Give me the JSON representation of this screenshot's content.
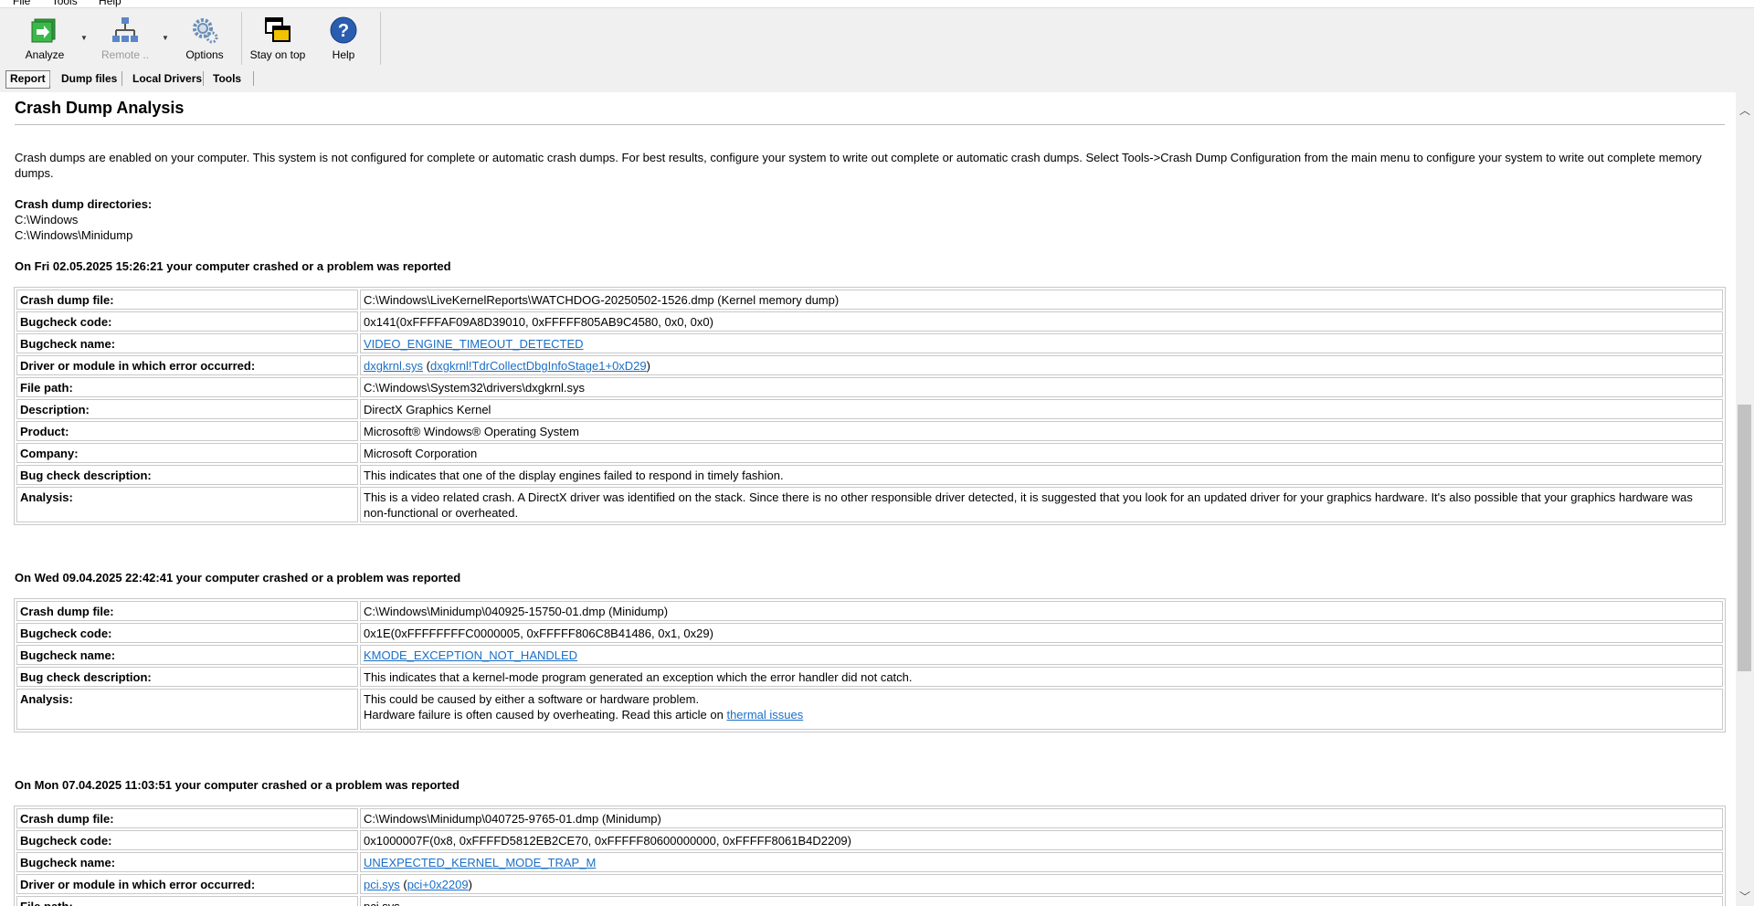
{
  "menu": [
    "File",
    "Tools",
    "Help"
  ],
  "toolbar": {
    "analyze": "Analyze",
    "remote": "Remote ..",
    "options": "Options",
    "stay_on_top": "Stay on top",
    "help": "Help"
  },
  "tabs": [
    "Report",
    "Dump files",
    "Local Drivers",
    "Tools"
  ],
  "report": {
    "title": "Crash Dump Analysis",
    "intro": "Crash dumps are enabled on your computer. This system is not configured for complete or automatic crash dumps. For best results, configure your system to write out complete or automatic crash dumps. Select Tools->Crash Dump Configuration from the main menu to configure your system to write out complete memory dumps.",
    "dirs_label": "Crash dump directories:",
    "dirs": [
      "C:\\Windows",
      "C:\\Windows\\Minidump"
    ]
  },
  "crashes": [
    {
      "title": "On Fri 02.05.2025 15:26:21 your computer crashed or a problem was reported",
      "crash_dump_file_label": "Crash dump file:",
      "crash_dump_file": "C:\\Windows\\LiveKernelReports\\WATCHDOG-20250502-1526.dmp (Kernel memory dump)",
      "bugcheck_code_label": "Bugcheck code:",
      "bugcheck_code": "0x141(0xFFFFAF09A8D39010, 0xFFFFF805AB9C4580, 0x0, 0x0)",
      "bugcheck_name_label": "Bugcheck name:",
      "bugcheck_name": "VIDEO_ENGINE_TIMEOUT_DETECTED",
      "driver_label": "Driver or module in which error occurred:",
      "driver": "dxgkrnl.sys",
      "driver_open": " (",
      "driver_symbol": "dxgkrnl!TdrCollectDbgInfoStage1+0xD29",
      "driver_close": ")",
      "file_path_label": "File path:",
      "file_path": "C:\\Windows\\System32\\drivers\\dxgkrnl.sys",
      "description_label": "Description:",
      "description": "DirectX Graphics Kernel",
      "product_label": "Product:",
      "product": "Microsoft® Windows® Operating System",
      "company_label": "Company:",
      "company": "Microsoft Corporation",
      "bug_check_desc_label": "Bug check description:",
      "bug_check_desc": "This indicates that one of the display engines failed to respond in timely fashion.",
      "analysis_label": "Analysis:",
      "analysis": "This is a video related crash. A DirectX driver was identified on the stack. Since there is no other responsible driver detected, it is suggested that you look for an updated driver for your graphics hardware. It's also possible that your graphics hardware was non-functional or overheated."
    },
    {
      "title": "On Wed 09.04.2025 22:42:41 your computer crashed or a problem was reported",
      "crash_dump_file_label": "Crash dump file:",
      "crash_dump_file": "C:\\Windows\\Minidump\\040925-15750-01.dmp (Minidump)",
      "bugcheck_code_label": "Bugcheck code:",
      "bugcheck_code": "0x1E(0xFFFFFFFFC0000005, 0xFFFFF806C8B41486, 0x1, 0x29)",
      "bugcheck_name_label": "Bugcheck name:",
      "bugcheck_name": "KMODE_EXCEPTION_NOT_HANDLED",
      "bug_check_desc_label": "Bug check description:",
      "bug_check_desc": "This indicates that a kernel-mode program generated an exception which the error handler did not catch.",
      "analysis_label": "Analysis:",
      "analysis_line1": "This could be caused by either a software or hardware problem.",
      "analysis_line2": "Hardware failure is often caused by overheating. Read this article on ",
      "analysis_link": "thermal issues"
    },
    {
      "title": "On Mon 07.04.2025 11:03:51 your computer crashed or a problem was reported",
      "crash_dump_file_label": "Crash dump file:",
      "crash_dump_file": "C:\\Windows\\Minidump\\040725-9765-01.dmp (Minidump)",
      "bugcheck_code_label": "Bugcheck code:",
      "bugcheck_code": "0x1000007F(0x8, 0xFFFFD5812EB2CE70, 0xFFFFF80600000000, 0xFFFFF8061B4D2209)",
      "bugcheck_name_label": "Bugcheck name:",
      "bugcheck_name": "UNEXPECTED_KERNEL_MODE_TRAP_M",
      "driver_label": "Driver or module in which error occurred:",
      "driver": "pci.sys",
      "driver_open": " (",
      "driver_symbol": "pci+0x2209",
      "driver_close": ")",
      "file_path_label": "File path:",
      "file_path": "pci.sys"
    }
  ],
  "colors": {
    "link": "#1a6fc7",
    "border": "#c8c8c8",
    "toolbar_bg": "#f0f0f0"
  },
  "icons": [
    "analyze-arrow-icon",
    "remote-network-icon",
    "options-gear-icon",
    "stay-on-top-windows-icon",
    "help-question-icon"
  ]
}
